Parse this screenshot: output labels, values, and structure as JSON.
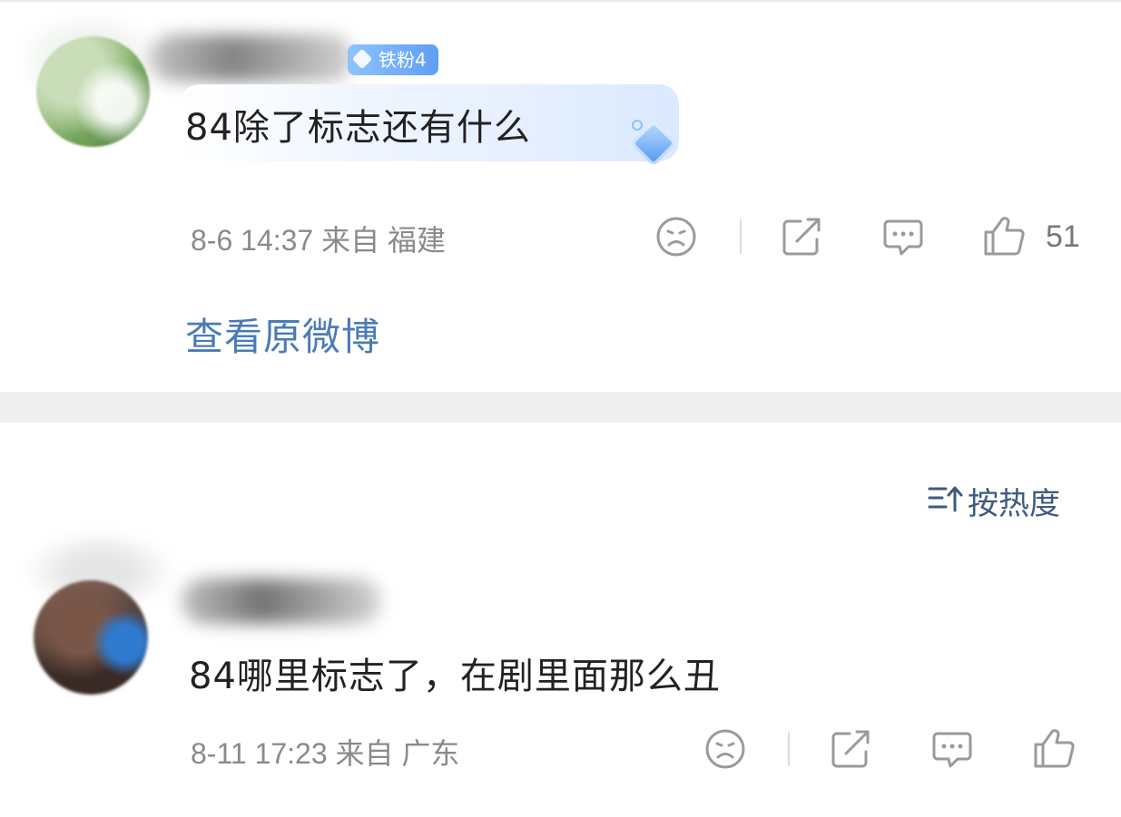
{
  "comment1": {
    "fan_badge": "铁粉4",
    "text": "84除了标志还有什么",
    "meta": "8-6 14:37 来自 福建",
    "like_count": "51"
  },
  "view_original": "查看原微博",
  "sort": {
    "label": "按热度"
  },
  "comment2": {
    "text": "84哪里标志了，在剧里面那么丑",
    "meta": "8-11 17:23 来自 广东"
  },
  "colors": {
    "link": "#4a7bb7",
    "badge": "#6aa8f7",
    "icon": "#9a9a9a",
    "divider": "#efefef"
  },
  "icons": [
    "unhappy-face-icon",
    "share-icon",
    "comment-icon",
    "thumbs-up-icon",
    "sort-icon",
    "diamond-icon"
  ]
}
